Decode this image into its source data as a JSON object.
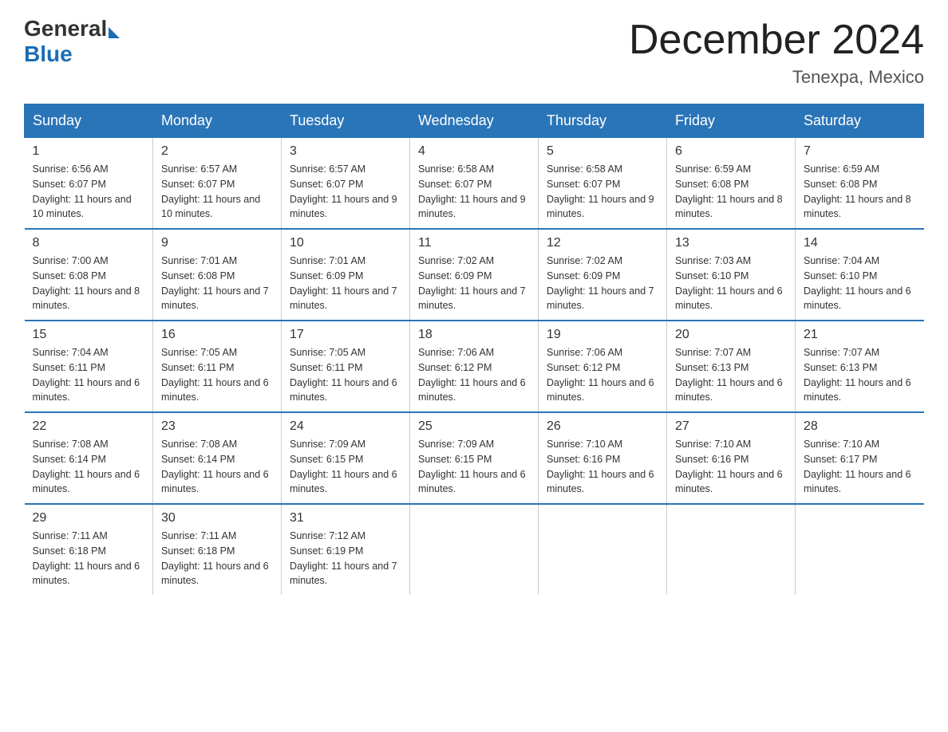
{
  "logo": {
    "general": "General",
    "blue": "Blue"
  },
  "title": "December 2024",
  "location": "Tenexpa, Mexico",
  "days_of_week": [
    "Sunday",
    "Monday",
    "Tuesday",
    "Wednesday",
    "Thursday",
    "Friday",
    "Saturday"
  ],
  "weeks": [
    [
      {
        "day": "1",
        "sunrise": "6:56 AM",
        "sunset": "6:07 PM",
        "daylight": "11 hours and 10 minutes."
      },
      {
        "day": "2",
        "sunrise": "6:57 AM",
        "sunset": "6:07 PM",
        "daylight": "11 hours and 10 minutes."
      },
      {
        "day": "3",
        "sunrise": "6:57 AM",
        "sunset": "6:07 PM",
        "daylight": "11 hours and 9 minutes."
      },
      {
        "day": "4",
        "sunrise": "6:58 AM",
        "sunset": "6:07 PM",
        "daylight": "11 hours and 9 minutes."
      },
      {
        "day": "5",
        "sunrise": "6:58 AM",
        "sunset": "6:07 PM",
        "daylight": "11 hours and 9 minutes."
      },
      {
        "day": "6",
        "sunrise": "6:59 AM",
        "sunset": "6:08 PM",
        "daylight": "11 hours and 8 minutes."
      },
      {
        "day": "7",
        "sunrise": "6:59 AM",
        "sunset": "6:08 PM",
        "daylight": "11 hours and 8 minutes."
      }
    ],
    [
      {
        "day": "8",
        "sunrise": "7:00 AM",
        "sunset": "6:08 PM",
        "daylight": "11 hours and 8 minutes."
      },
      {
        "day": "9",
        "sunrise": "7:01 AM",
        "sunset": "6:08 PM",
        "daylight": "11 hours and 7 minutes."
      },
      {
        "day": "10",
        "sunrise": "7:01 AM",
        "sunset": "6:09 PM",
        "daylight": "11 hours and 7 minutes."
      },
      {
        "day": "11",
        "sunrise": "7:02 AM",
        "sunset": "6:09 PM",
        "daylight": "11 hours and 7 minutes."
      },
      {
        "day": "12",
        "sunrise": "7:02 AM",
        "sunset": "6:09 PM",
        "daylight": "11 hours and 7 minutes."
      },
      {
        "day": "13",
        "sunrise": "7:03 AM",
        "sunset": "6:10 PM",
        "daylight": "11 hours and 6 minutes."
      },
      {
        "day": "14",
        "sunrise": "7:04 AM",
        "sunset": "6:10 PM",
        "daylight": "11 hours and 6 minutes."
      }
    ],
    [
      {
        "day": "15",
        "sunrise": "7:04 AM",
        "sunset": "6:11 PM",
        "daylight": "11 hours and 6 minutes."
      },
      {
        "day": "16",
        "sunrise": "7:05 AM",
        "sunset": "6:11 PM",
        "daylight": "11 hours and 6 minutes."
      },
      {
        "day": "17",
        "sunrise": "7:05 AM",
        "sunset": "6:11 PM",
        "daylight": "11 hours and 6 minutes."
      },
      {
        "day": "18",
        "sunrise": "7:06 AM",
        "sunset": "6:12 PM",
        "daylight": "11 hours and 6 minutes."
      },
      {
        "day": "19",
        "sunrise": "7:06 AM",
        "sunset": "6:12 PM",
        "daylight": "11 hours and 6 minutes."
      },
      {
        "day": "20",
        "sunrise": "7:07 AM",
        "sunset": "6:13 PM",
        "daylight": "11 hours and 6 minutes."
      },
      {
        "day": "21",
        "sunrise": "7:07 AM",
        "sunset": "6:13 PM",
        "daylight": "11 hours and 6 minutes."
      }
    ],
    [
      {
        "day": "22",
        "sunrise": "7:08 AM",
        "sunset": "6:14 PM",
        "daylight": "11 hours and 6 minutes."
      },
      {
        "day": "23",
        "sunrise": "7:08 AM",
        "sunset": "6:14 PM",
        "daylight": "11 hours and 6 minutes."
      },
      {
        "day": "24",
        "sunrise": "7:09 AM",
        "sunset": "6:15 PM",
        "daylight": "11 hours and 6 minutes."
      },
      {
        "day": "25",
        "sunrise": "7:09 AM",
        "sunset": "6:15 PM",
        "daylight": "11 hours and 6 minutes."
      },
      {
        "day": "26",
        "sunrise": "7:10 AM",
        "sunset": "6:16 PM",
        "daylight": "11 hours and 6 minutes."
      },
      {
        "day": "27",
        "sunrise": "7:10 AM",
        "sunset": "6:16 PM",
        "daylight": "11 hours and 6 minutes."
      },
      {
        "day": "28",
        "sunrise": "7:10 AM",
        "sunset": "6:17 PM",
        "daylight": "11 hours and 6 minutes."
      }
    ],
    [
      {
        "day": "29",
        "sunrise": "7:11 AM",
        "sunset": "6:18 PM",
        "daylight": "11 hours and 6 minutes."
      },
      {
        "day": "30",
        "sunrise": "7:11 AM",
        "sunset": "6:18 PM",
        "daylight": "11 hours and 6 minutes."
      },
      {
        "day": "31",
        "sunrise": "7:12 AM",
        "sunset": "6:19 PM",
        "daylight": "11 hours and 7 minutes."
      },
      null,
      null,
      null,
      null
    ]
  ]
}
